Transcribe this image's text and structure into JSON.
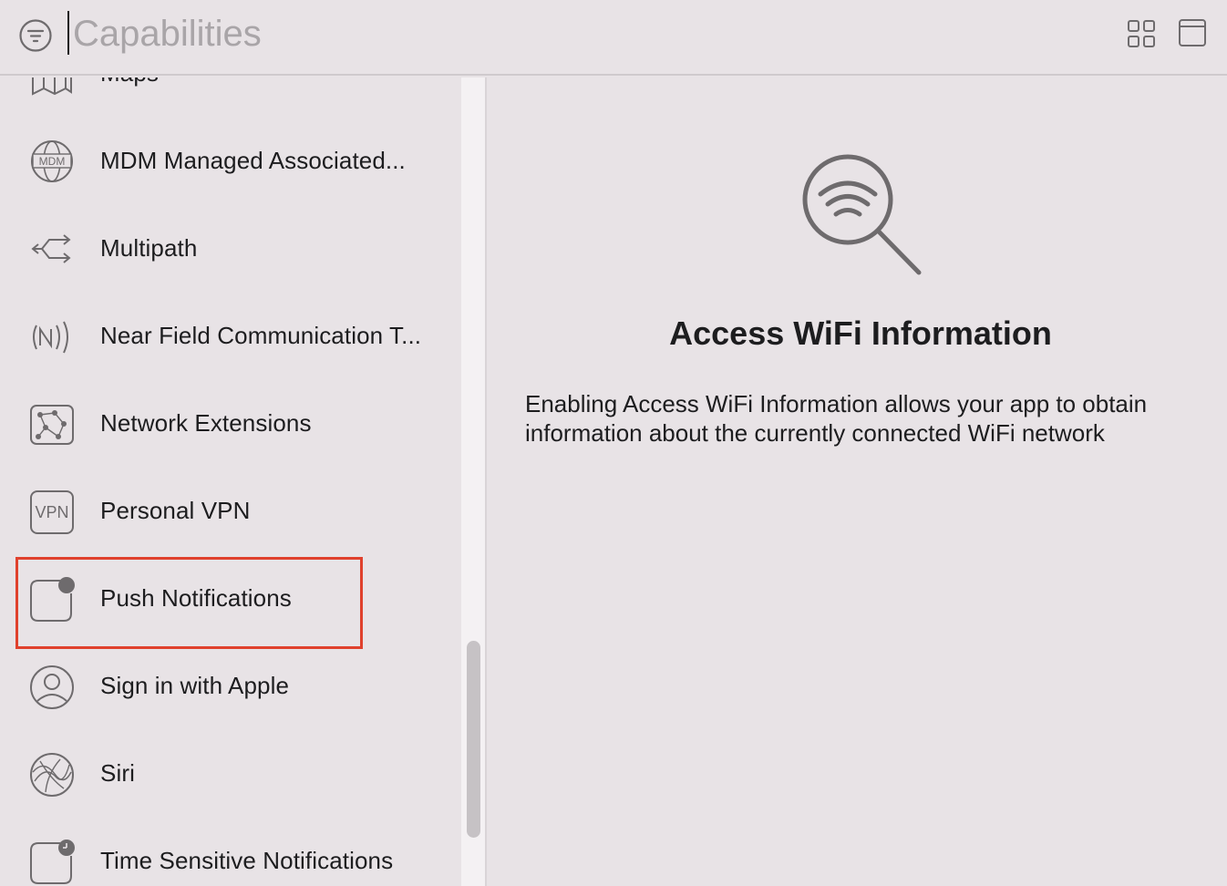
{
  "search": {
    "placeholder": "Capabilities"
  },
  "sidebar": {
    "items": [
      {
        "label": "Maps",
        "icon": "map-icon"
      },
      {
        "label": "MDM Managed Associated...",
        "icon": "mdm-globe-icon"
      },
      {
        "label": "Multipath",
        "icon": "multipath-arrows-icon"
      },
      {
        "label": "Near Field Communication T...",
        "icon": "nfc-icon"
      },
      {
        "label": "Network Extensions",
        "icon": "network-extensions-icon"
      },
      {
        "label": "Personal VPN",
        "icon": "vpn-icon"
      },
      {
        "label": "Push Notifications",
        "icon": "push-notification-icon"
      },
      {
        "label": "Sign in with Apple",
        "icon": "person-circle-icon"
      },
      {
        "label": "Siri",
        "icon": "siri-icon"
      },
      {
        "label": "Time Sensitive Notifications",
        "icon": "time-sensitive-icon"
      }
    ],
    "vpn_icon_text": "VPN",
    "mdm_icon_text": "MDM"
  },
  "detail": {
    "title": "Access WiFi Information",
    "description": "Enabling Access WiFi Information allows your app to obtain information about the currently connected WiFi network",
    "icon": "wifi-search-icon"
  },
  "colors": {
    "background": "#e8e3e6",
    "highlight": "#e0412d",
    "icon_gray": "#6e6b6d"
  }
}
